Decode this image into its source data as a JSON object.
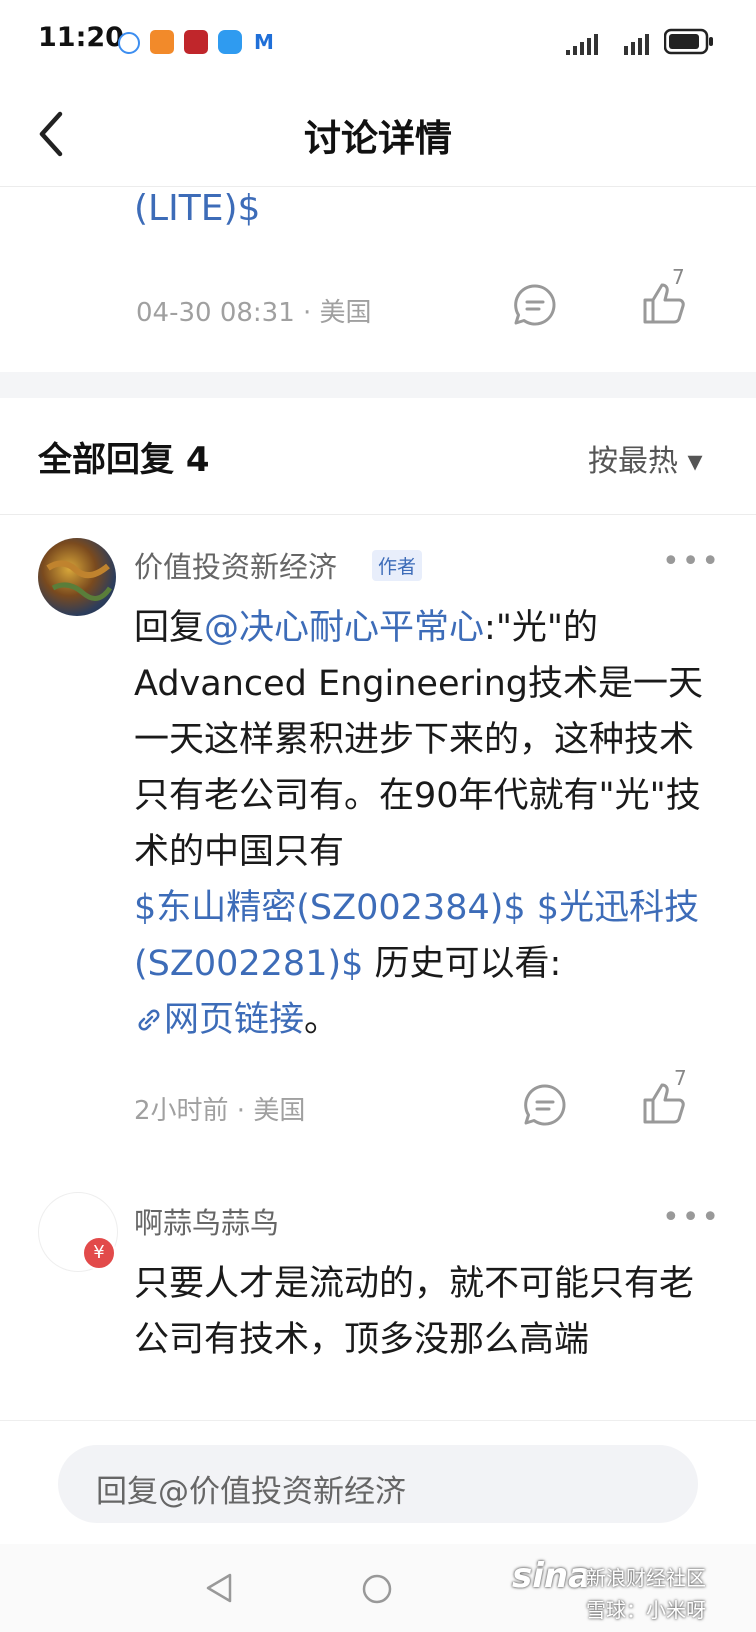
{
  "status_bar": {
    "time": "11:20"
  },
  "header": {
    "title": "讨论详情"
  },
  "post": {
    "tail_text": "(LITE)$",
    "meta": "04-30 08:31 · 美国",
    "like_count": "7"
  },
  "replies_section": {
    "title": "全部回复 4",
    "sort_label": "按最热 ▾"
  },
  "replies": [
    {
      "user": "价值投资新经济",
      "badge": "作者",
      "more": "•••",
      "text_prefix": "回复",
      "mention": "@决心耐心平常心",
      "text_a": ":\"光\"的Advanced Engineering技术是一天一天这样累积进步下来的，这种技术只有老公司有。在90年代就有\"光\"技术的中国只有",
      "stock1": "$东山精密(SZ002384)$",
      "stock2": "$光迅科技(SZ002281)$",
      "text_b": " 历史可以看:",
      "link_label": "网页链接",
      "text_end": "。",
      "meta": "2小时前 · 美国",
      "like_count": "7"
    },
    {
      "user": "啊蒜鸟蒜鸟",
      "more": "•••",
      "text": "只要人才是流动的，就不可能只有老公司有技术，顶多没那么高端"
    }
  ],
  "reply_bar": {
    "placeholder": "回复@价值投资新经济"
  },
  "watermark": {
    "line1": "新浪财经社区",
    "line2": "雪球：小米呀",
    "logo": "sina"
  },
  "colors": {
    "link": "#3d6cb8",
    "meta": "#a0a0a0",
    "badge_bg": "#e8eefb"
  }
}
